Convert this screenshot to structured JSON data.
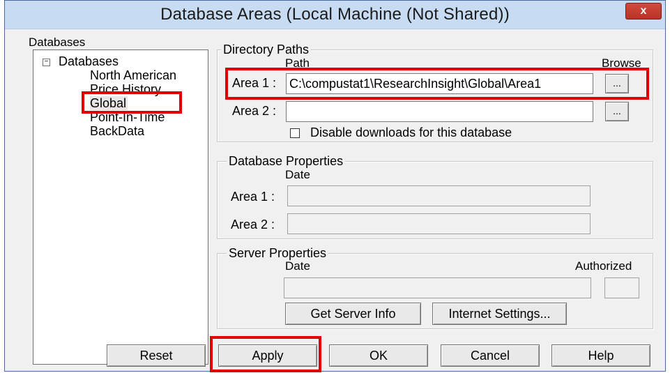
{
  "window": {
    "title": "Database Areas  (Local Machine (Not Shared))",
    "close_label": "x"
  },
  "databases_panel": {
    "label": "Databases",
    "tree_root": "Databases",
    "toggle_symbol": "−",
    "items": [
      {
        "label": "North American"
      },
      {
        "label": "Price History"
      },
      {
        "label": "Global"
      },
      {
        "label": "Point-In-Time"
      },
      {
        "label": "BackData"
      }
    ],
    "selected": "Global"
  },
  "directory_paths": {
    "title": "Directory Paths",
    "path_header": "Path",
    "browse_header": "Browse",
    "area1_label": "Area 1 :",
    "area1_value": "C:\\compustat1\\ResearchInsight\\Global\\Area1",
    "area2_label": "Area 2 :",
    "area2_value": "",
    "browse_button_label": "...",
    "disable_downloads_label": "Disable downloads for this database",
    "disable_downloads_checked": false
  },
  "database_properties": {
    "title": "Database Properties",
    "date_header": "Date",
    "area1_label": "Area 1 :",
    "area1_value": "",
    "area2_label": "Area 2 :",
    "area2_value": ""
  },
  "server_properties": {
    "title": "Server Properties",
    "date_header": "Date",
    "authorized_header": "Authorized",
    "date_value": "",
    "authorized_value": "",
    "get_server_info_label": "Get Server Info",
    "internet_settings_label": "Internet Settings..."
  },
  "footer_buttons": {
    "reset": "Reset",
    "apply": "Apply",
    "ok": "OK",
    "cancel": "Cancel",
    "help": "Help"
  },
  "colors": {
    "highlight": "#e00000",
    "titlebar": "#c7dcf3",
    "close": "#c8392c"
  }
}
